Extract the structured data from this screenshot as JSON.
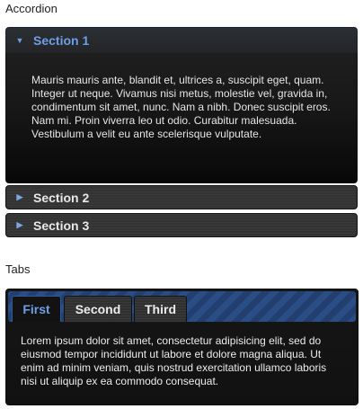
{
  "accordion": {
    "heading": "Accordion",
    "sections": [
      {
        "label": "Section 1",
        "icon": "triangle-down-icon",
        "expanded": true,
        "content": "Mauris mauris ante, blandit et, ultrices a, suscipit eget, quam. Integer ut neque. Vivamus nisi metus, molestie vel, gravida in, condimentum sit amet, nunc. Nam a nibh. Donec suscipit eros. Nam mi. Proin viverra leo ut odio. Curabitur malesuada. Vestibulum a velit eu ante scelerisque vulputate."
      },
      {
        "label": "Section 2",
        "icon": "triangle-right-icon",
        "expanded": false
      },
      {
        "label": "Section 3",
        "icon": "triangle-right-icon",
        "expanded": false
      }
    ]
  },
  "tabs": {
    "heading": "Tabs",
    "items": [
      {
        "label": "First",
        "active": true
      },
      {
        "label": "Second",
        "active": false
      },
      {
        "label": "Third",
        "active": false
      }
    ],
    "panel": "Lorem ipsum dolor sit amet, consectetur adipisicing elit, sed do eiusmod tempor incididunt ut labore et dolore magna aliqua. Ut enim ad minim veniam, quis nostrud exercitation ullamco laboris nisi ut aliquip ex ea commodo consequat."
  },
  "colors": {
    "accent": "#6e9fe6",
    "header_bg": "#353535",
    "content_bg": "#141414",
    "tabbar_stripe": "#2b4d86"
  }
}
